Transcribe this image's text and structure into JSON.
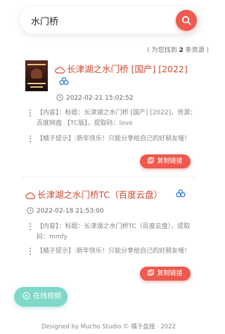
{
  "search": {
    "value": "水门桥"
  },
  "results_summary": {
    "prefix": "( 为您找到 ",
    "count": "2",
    "suffix": " 条资源 )"
  },
  "results": [
    {
      "title": "长津湖之水门桥 [国产] [2022]",
      "date": "2022-02-21 15:02:52",
      "content": "【内容】：标题：长津湖之水门桥 [国产] [2022]，资源：百度网盘 【TC版】，提取码：love",
      "tip": "【橘子提示】:新年快乐！只能分享给自己的好朋友哦！",
      "copy_label": "复制链接",
      "poster_text": "长津湖之水门桥"
    },
    {
      "title": "长津湖之水门桥TC（百度云盘）",
      "date": "2022-02-18 21:53:00",
      "content": "【内容】：标题：长津湖之水门桥TC（百度云盘），提取码：mmfy",
      "tip": "【橘子提示】:新年快乐！只能分享给自己的好朋友哦！",
      "copy_label": "复制链接"
    }
  ],
  "online_button": {
    "label": "在线视频"
  },
  "footer": {
    "text": "Designed by Mucho Studio © 橘子盘搜 · 2022"
  },
  "colors": {
    "accent": "#ee5a4e",
    "title": "#d04a32",
    "online": "#7fd8c9"
  },
  "icons": [
    "search-icon",
    "cloud-icon",
    "baidu-pan-icon",
    "clock-icon",
    "copy-icon",
    "play-icon"
  ]
}
